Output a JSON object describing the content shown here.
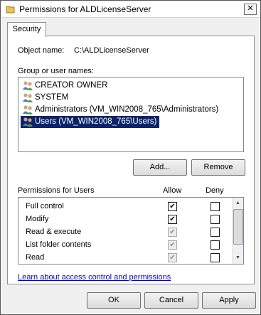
{
  "window": {
    "title": "Permissions for ALDLicenseServer",
    "close_glyph": "✕"
  },
  "tabs": [
    {
      "label": "Security"
    }
  ],
  "object": {
    "label": "Object name:",
    "value": "C:\\ALDLicenseServer"
  },
  "groups": {
    "label": "Group or user names:",
    "items": [
      {
        "label": "CREATOR OWNER",
        "icon": "users-icon"
      },
      {
        "label": "SYSTEM",
        "icon": "users-icon"
      },
      {
        "label": "Administrators (VM_WIN2008_765\\Administrators)",
        "icon": "users-icon"
      },
      {
        "label": "Users (VM_WIN2008_765\\Users)",
        "icon": "users-icon",
        "selected": true
      }
    ]
  },
  "buttons": {
    "add": "Add...",
    "remove": "Remove",
    "ok": "OK",
    "cancel": "Cancel",
    "apply": "Apply"
  },
  "permissions": {
    "label": "Permissions for Users",
    "allow_header": "Allow",
    "deny_header": "Deny",
    "rows": [
      {
        "name": "Full control",
        "allow": true,
        "allow_disabled": false,
        "deny": false
      },
      {
        "name": "Modify",
        "allow": true,
        "allow_disabled": false,
        "deny": false
      },
      {
        "name": "Read & execute",
        "allow": true,
        "allow_disabled": true,
        "deny": false
      },
      {
        "name": "List folder contents",
        "allow": true,
        "allow_disabled": true,
        "deny": false
      },
      {
        "name": "Read",
        "allow": true,
        "allow_disabled": true,
        "deny": false
      }
    ]
  },
  "link": "Learn about access control and permissions"
}
